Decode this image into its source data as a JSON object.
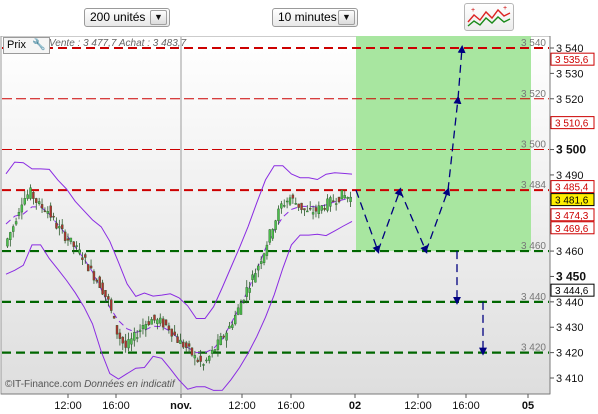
{
  "toolbar": {
    "quantity_select": "200 unités",
    "period_select": "10 minutes",
    "strategy_icon": "chart-strategy-icon"
  },
  "header": {
    "prix_label": "Prix",
    "settings_icon": "wrench-icon",
    "quote_text": "Vente : 3 477,7 Achat : 3 483,7"
  },
  "footer": {
    "brand": "©IT-Finance.com",
    "disclaimer": "Données en indicatif"
  },
  "colors": {
    "resistance_line": "#cc0000",
    "support_line": "#006600",
    "bull_zone": "#a8e6a0",
    "bear_zone": "#f4a8a8",
    "bollinger": "#8a2be2",
    "candles": "#2f8f2f",
    "projection_arrows": "#000080"
  },
  "chart_data": {
    "type": "candlestick",
    "y_axis_ticks": [
      "3 540",
      "3 530",
      "3 520",
      "3 510",
      "3 500",
      "3 490",
      "3 480",
      "3 470",
      "3 460",
      "3 450",
      "3 440",
      "3 430",
      "3 420",
      "3 410"
    ],
    "bold_ticks": [
      "3 500",
      "3 450"
    ],
    "x_axis_ticks": [
      "12:00",
      "16:00",
      "nov.",
      "12:00",
      "16:00",
      "02",
      "12:00",
      "16:00",
      "05"
    ],
    "bold_x_ticks": [
      "nov.",
      "02",
      "05"
    ],
    "price_badges": [
      {
        "value": "3 535,6",
        "color": "#cc0000"
      },
      {
        "value": "3 510,6",
        "color": "#cc0000"
      },
      {
        "value": "3 485,4",
        "color": "#cc0000"
      },
      {
        "value": "3 481,6",
        "color": "#000000",
        "highlight": true
      },
      {
        "value": "3 474,3",
        "color": "#cc0000"
      },
      {
        "value": "3 469,6",
        "color": "#cc0000"
      },
      {
        "value": "3 444,6",
        "color": "#000000"
      }
    ],
    "level_labels": [
      {
        "text": "3 540",
        "value": 3540
      },
      {
        "text": "3 520",
        "value": 3520
      },
      {
        "text": "3 500",
        "value": 3500
      },
      {
        "text": "3 484",
        "value": 3484
      },
      {
        "text": "3 460",
        "value": 3460
      },
      {
        "text": "3 440",
        "value": 3440
      },
      {
        "text": "3 420",
        "value": 3420
      }
    ],
    "resistance_levels": [
      3540,
      3520,
      3500,
      3484
    ],
    "support_levels": [
      3460,
      3440,
      3420
    ],
    "ylim": [
      3404,
      3546
    ],
    "bull_zone": {
      "from": 3460,
      "to": 3546
    },
    "bear_zone": {
      "from": 3404,
      "to": 3460
    },
    "projection": [
      3484,
      3460,
      3484,
      3460,
      3484,
      3520,
      3540
    ],
    "projection_down": [
      [
        3460,
        3440
      ],
      [
        3440,
        3420
      ]
    ],
    "price_path": [
      3462,
      3470,
      3480,
      3483,
      3478,
      3476,
      3470,
      3466,
      3462,
      3458,
      3452,
      3447,
      3440,
      3428,
      3422,
      3426,
      3431,
      3433,
      3432,
      3430,
      3425,
      3422,
      3418,
      3415,
      3420,
      3425,
      3430,
      3437,
      3445,
      3452,
      3460,
      3470,
      3478,
      3481,
      3478,
      3475,
      3476,
      3478,
      3480,
      3482,
      3481
    ]
  }
}
